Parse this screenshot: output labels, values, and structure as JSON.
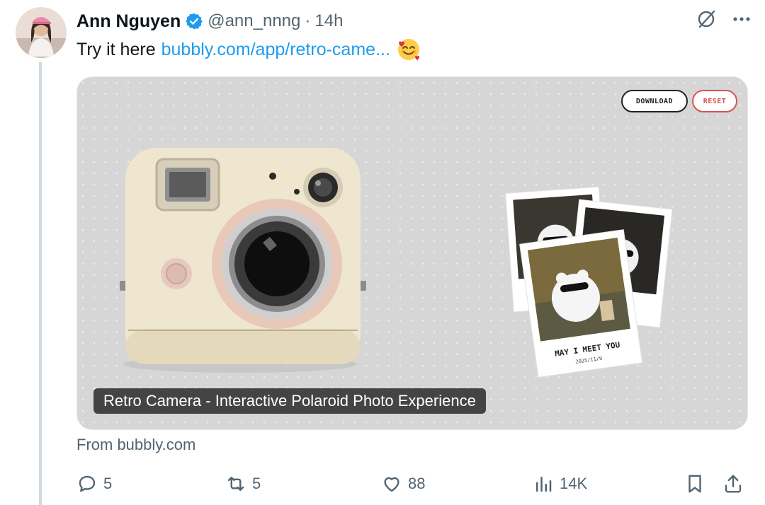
{
  "author": {
    "name": "Ann Nguyen",
    "handle": "@ann_nnng",
    "separator": "·",
    "time": "14h",
    "avatar_icon": "avatar-photo",
    "verified_icon": "verified-badge-icon"
  },
  "tweet": {
    "text_prefix": "Try it here",
    "link_text": "bubbly.com/app/retro-came...",
    "emoji": "smiling-face-with-hearts"
  },
  "card": {
    "download_label": "DOWNLOAD",
    "reset_label": "RESET",
    "polaroid_caption": "MAY I MEET YOU",
    "polaroid_date": "2025/11/9",
    "title": "Retro Camera - Interactive Polaroid Photo Experience"
  },
  "source": "From bubbly.com",
  "actions": {
    "replies": "5",
    "reposts": "5",
    "likes": "88",
    "views": "14K"
  },
  "colors": {
    "link": "#1d9bf0",
    "verified": "#1d9bf0",
    "muted": "#536471",
    "reset_accent": "#d9534f"
  }
}
